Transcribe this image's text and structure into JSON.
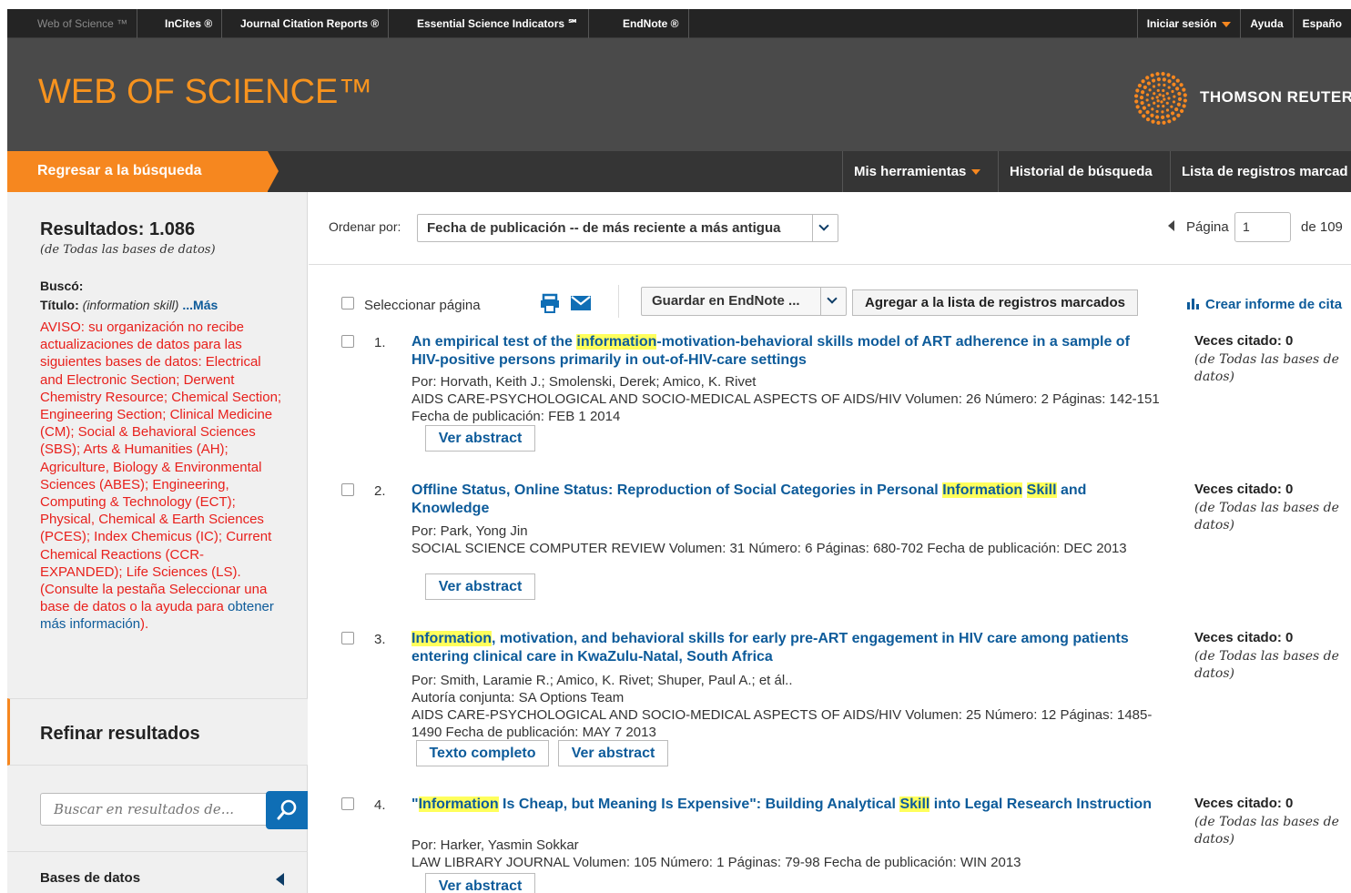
{
  "topnav": {
    "items": [
      "Web of Science ™",
      "InCites ®",
      "Journal Citation Reports ®",
      "Essential Science Indicators ℠",
      "EndNote ®"
    ],
    "login": "Iniciar sesión",
    "help": "Ayuda",
    "lang": "Españo"
  },
  "header": {
    "title": "WEB OF SCIENCE™",
    "brand": "THOMSON REUTER"
  },
  "subnav": {
    "back": "Regresar a la búsqueda",
    "tools": "Mis herramientas",
    "history": "Historial de búsqueda",
    "marked": "Lista de registros marcad"
  },
  "sidebar": {
    "results": "Resultados: 1.086",
    "results_db": "(de Todas las bases de datos)",
    "searched_label": "Buscó:",
    "field_label": "Título:",
    "query": "(information skill)",
    "more": "...Más",
    "warning": "AVISO: su organización no recibe actualizaciones de datos para las siguientes bases de datos: Electrical and Electronic Section; Derwent Chemistry Resource; Chemical Section; Engineering Section; Clinical Medicine (CM); Social & Behavioral Sciences (SBS); Arts & Humanities (AH); Agriculture, Biology & Environmental Sciences (ABES); Engineering, Computing & Technology (ECT); Physical, Chemical & Earth Sciences (PCES); Index Chemicus (IC); Current Chemical Reactions (CCR-EXPANDED); Life Sciences (LS). (Consulte la pestaña Seleccionar una base de datos o la ayuda para ",
    "warning_link": "obtener más información",
    "warning_end": ").",
    "refine": "Refinar resultados",
    "search_placeholder": "Buscar en resultados de...",
    "databases": "Bases de datos"
  },
  "sort": {
    "label": "Ordenar por:",
    "value": "Fecha de publicación -- de más reciente a más antigua"
  },
  "pager": {
    "label": "Página",
    "value": "1",
    "of": "de  109"
  },
  "toolbar": {
    "select_page": "Seleccionar página",
    "endnote": "Guardar en EndNote ...",
    "add_marked": "Agregar a la lista de registros marcados",
    "report": "Crear informe de cita"
  },
  "records": [
    {
      "num": "1.",
      "title_parts": [
        "An empirical test of the ",
        "information",
        "-motivation-behavioral skills model of ART adherence in a sample of HIV-positive persons primarily in out-of-HIV-care settings"
      ],
      "authors": "Por: Horvath, Keith J.; Smolenski, Derek; Amico, K. Rivet",
      "coauthor": "",
      "source": "AIDS CARE-PSYCHOLOGICAL AND SOCIO-MEDICAL ASPECTS OF AIDS/HIV  Volumen: 26   Número: 2   Páginas: 142-151   Fecha de publicación: FEB 1 2014",
      "buttons": [
        "Ver abstract"
      ],
      "cites": "Veces citado: 0",
      "cites_db": "(de Todas las bases de datos)"
    },
    {
      "num": "2.",
      "title_parts": [
        "Offline Status, Online Status: Reproduction of Social Categories in Personal ",
        "Information",
        " ",
        "Skill",
        " and Knowledge"
      ],
      "authors": "Por: Park, Yong Jin",
      "coauthor": "",
      "source": "SOCIAL SCIENCE COMPUTER REVIEW  Volumen: 31   Número: 6   Páginas: 680-702   Fecha de publicación: DEC 2013",
      "buttons": [
        "Ver abstract"
      ],
      "cites": "Veces citado: 0",
      "cites_db": "(de Todas las bases de datos)"
    },
    {
      "num": "3.",
      "title_parts": [
        "",
        "Information",
        ", motivation, and behavioral skills for early pre-ART engagement in HIV care among patients entering clinical care in KwaZulu-Natal, South Africa"
      ],
      "authors": "Por: Smith, Laramie R.; Amico, K. Rivet; Shuper, Paul A.; et ál..",
      "coauthor": "Autoría conjunta: SA Options Team",
      "source": "AIDS CARE-PSYCHOLOGICAL AND SOCIO-MEDICAL ASPECTS OF AIDS/HIV  Volumen: 25   Número: 12   Páginas: 1485-1490   Fecha de publicación: MAY 7 2013",
      "buttons": [
        "Texto completo",
        "Ver abstract"
      ],
      "cites": "Veces citado: 0",
      "cites_db": "(de Todas las bases de datos)"
    },
    {
      "num": "4.",
      "title_parts": [
        "\"",
        "Information",
        " Is Cheap, but Meaning Is Expensive\": Building Analytical ",
        "Skill",
        " into Legal Research Instruction"
      ],
      "authors": "Por: Harker, Yasmin Sokkar",
      "coauthor": "",
      "source": "LAW LIBRARY JOURNAL  Volumen: 105   Número: 1   Páginas: 79-98   Fecha de publicación: WIN 2013",
      "buttons": [
        "Ver abstract"
      ],
      "cites": "Veces citado: 0",
      "cites_db": "(de Todas las bases de datos)"
    }
  ],
  "colors": {
    "orange": "#f6871f",
    "link": "#0d5b9a",
    "warning": "#e8201c",
    "highlight": "#ffff5c"
  }
}
